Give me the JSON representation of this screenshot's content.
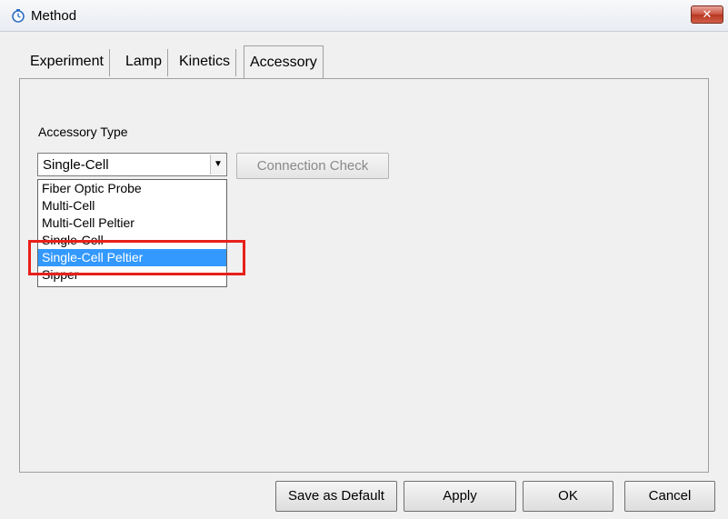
{
  "window": {
    "title": "Method",
    "close_icon": "close-icon",
    "app_icon": "timer-icon"
  },
  "tabs": [
    {
      "label": "Experiment",
      "active": false
    },
    {
      "label": "Lamp",
      "active": false
    },
    {
      "label": "Kinetics",
      "active": false
    },
    {
      "label": "Accessory",
      "active": true
    }
  ],
  "accessory": {
    "label": "Accessory Type",
    "selected_value": "Single-Cell",
    "connection_check_label": "Connection Check",
    "options": [
      "Fiber Optic Probe",
      "Multi-Cell",
      "Multi-Cell Peltier",
      "Single-Cell",
      "Single-Cell Peltier",
      "Sipper"
    ],
    "highlighted_option": "Single-Cell Peltier"
  },
  "buttons": {
    "save_default": "Save as Default",
    "apply": "Apply",
    "ok": "OK",
    "cancel": "Cancel"
  },
  "colors": {
    "selection": "#3399ff",
    "annotation_box": "#e8201a",
    "close_button": "#c9513f"
  }
}
